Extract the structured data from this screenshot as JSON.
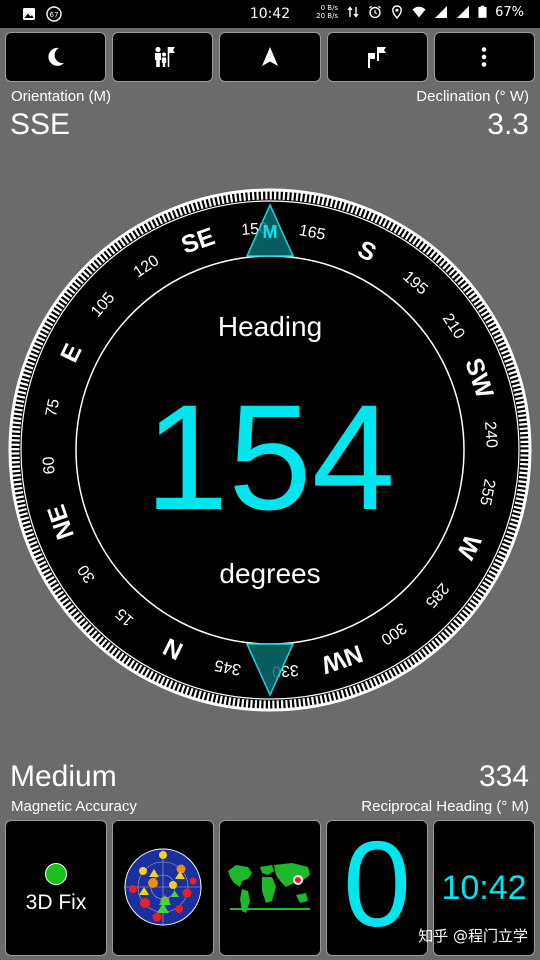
{
  "status": {
    "time": "10:42",
    "net_up": "0 B/s",
    "net_down": "20 B/s",
    "battery": "67%",
    "notification_badge": "67"
  },
  "toolbar": [
    {
      "icon": "moon-icon"
    },
    {
      "icon": "people-flag-icon"
    },
    {
      "icon": "navigation-arrow-icon"
    },
    {
      "icon": "waypoints-flag-icon"
    },
    {
      "icon": "more-vertical-icon"
    }
  ],
  "orientation": {
    "label": "Orientation (M)",
    "value": "SSE"
  },
  "declination": {
    "label": "Declination (° W)",
    "value": "3.3"
  },
  "compass": {
    "heading_label": "Heading",
    "heading_value": "154",
    "unit_label": "degrees",
    "bezel_marker": "M",
    "heading_deg": 154
  },
  "accuracy": {
    "value": "Medium",
    "label": "Magnetic Accuracy"
  },
  "reciprocal": {
    "value": "334",
    "label": "Reciprocal Heading (° M)"
  },
  "tiles": {
    "fix": "3D Fix",
    "counter": "0",
    "clock": "10:42"
  },
  "watermark": "知乎 @程门立学",
  "colors": {
    "accent": "#00e5ee",
    "fix_green": "#17c21a",
    "background": "#6b6b6b"
  }
}
